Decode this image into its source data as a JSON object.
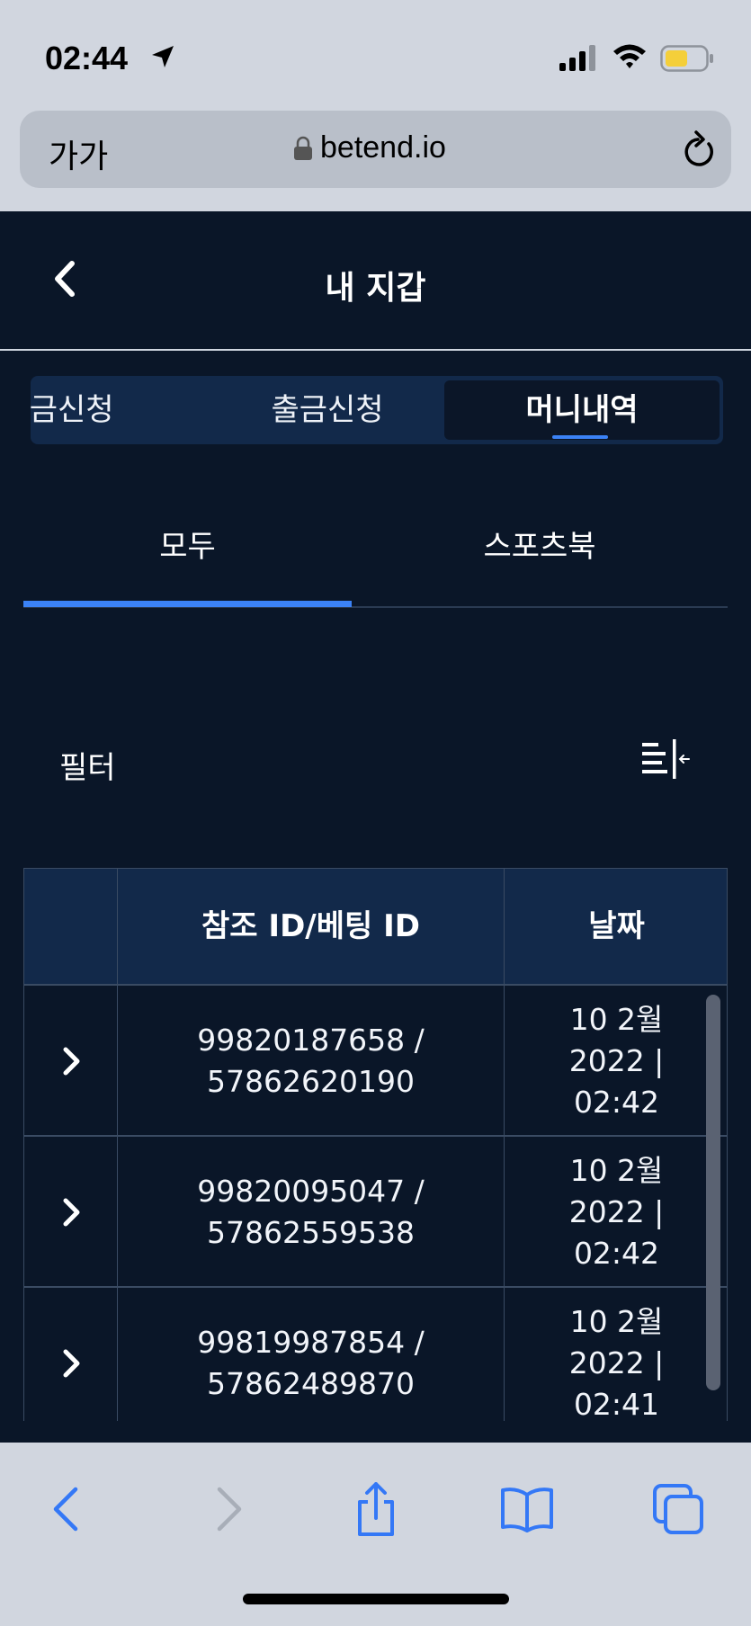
{
  "status_bar": {
    "time": "02:44"
  },
  "address_bar": {
    "text_size_label": "가가",
    "url": "betend.io"
  },
  "header": {
    "title": "내 지갑"
  },
  "segments": [
    {
      "label": "입금신청"
    },
    {
      "label": "출금신청"
    },
    {
      "label": "머니내역"
    }
  ],
  "subtabs": [
    {
      "label": "모두"
    },
    {
      "label": "스포츠북"
    }
  ],
  "filter": {
    "label": "필터"
  },
  "table": {
    "headers": [
      "",
      "참조 ID/베팅 ID",
      "날짜"
    ],
    "rows": [
      {
        "ref_id": "99820187658 /",
        "bet_id": "57862620190",
        "date_line1": "10 2월",
        "date_line2": "2022 |",
        "date_line3": "02:42"
      },
      {
        "ref_id": "99820095047 /",
        "bet_id": "57862559538",
        "date_line1": "10 2월",
        "date_line2": "2022 |",
        "date_line3": "02:42"
      },
      {
        "ref_id": "99819987854 /",
        "bet_id": "57862489870",
        "date_line1": "10 2월",
        "date_line2": "2022 |",
        "date_line3": "02:41"
      }
    ]
  },
  "colors": {
    "background": "#0a1628",
    "accent": "#3b82f6",
    "header_bg": "#12294a",
    "safari_chrome": "#d1d6df",
    "safari_blue": "#3478f6"
  },
  "icons": [
    "location-arrow-icon",
    "signal-icon",
    "wifi-icon",
    "battery-icon",
    "lock-icon",
    "reload-icon",
    "back-chevron-icon",
    "filter-collapse-icon",
    "chevron-right-icon",
    "share-icon",
    "bookmarks-icon",
    "tabs-icon"
  ]
}
